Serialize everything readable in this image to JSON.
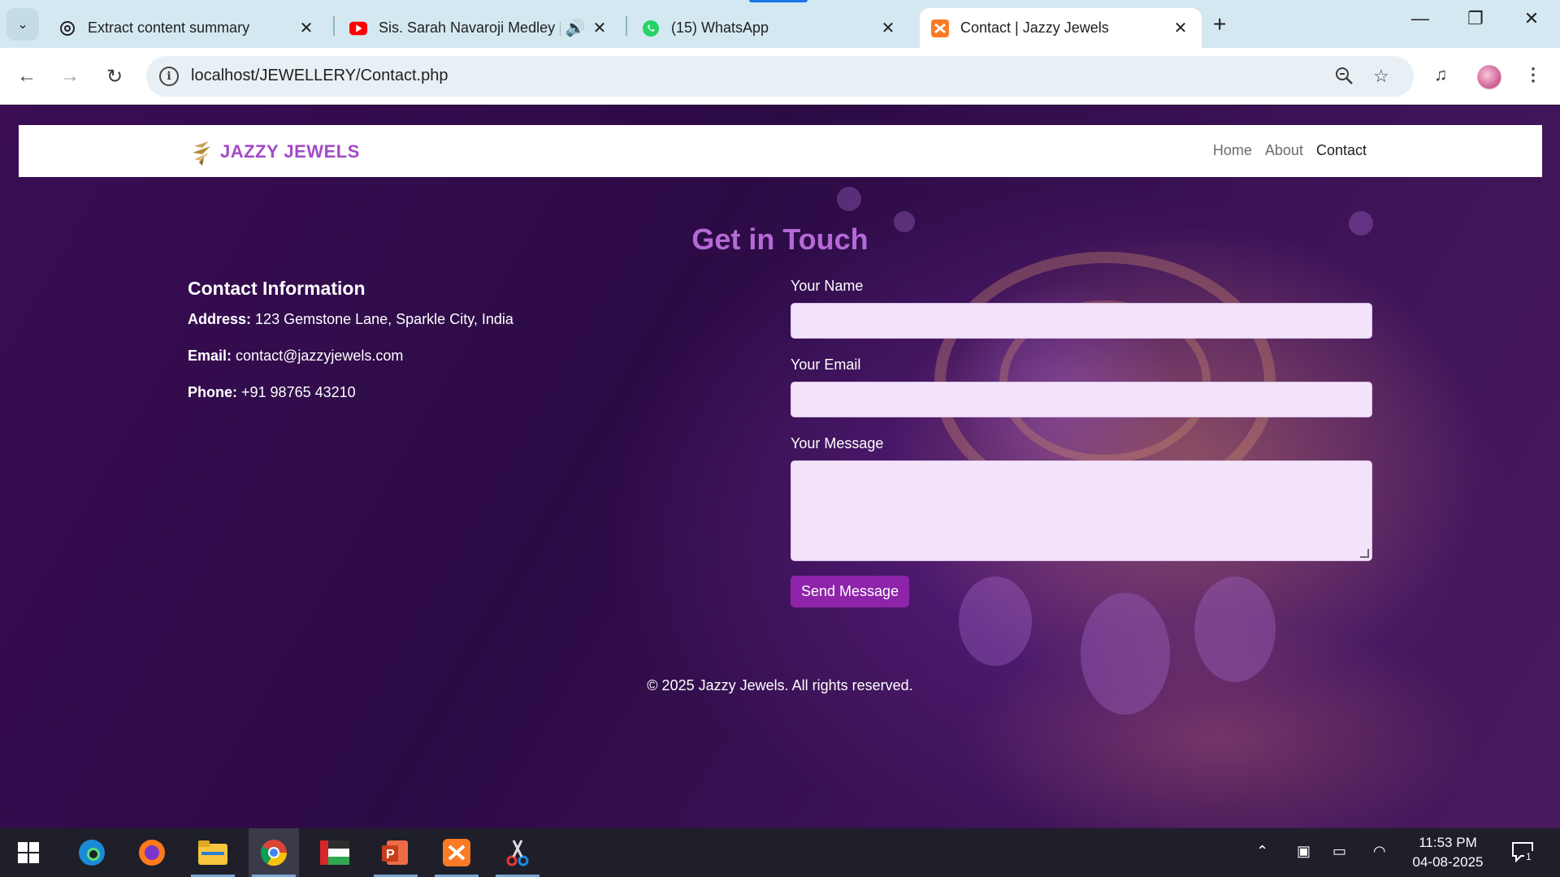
{
  "browser": {
    "tabs": [
      {
        "title": "Extract content summary",
        "icon": "openai-icon"
      },
      {
        "title": "Sis. Sarah Navaroji Medley |",
        "icon": "youtube-icon",
        "audio": true
      },
      {
        "title": "(15) WhatsApp",
        "icon": "whatsapp-icon"
      },
      {
        "title": "Contact | Jazzy Jewels",
        "icon": "xampp-icon",
        "active": true
      }
    ],
    "url": "localhost/JEWELLERY/Contact.php"
  },
  "site": {
    "brand": "JAZZY JEWELS",
    "nav": [
      "Home",
      "About",
      "Contact"
    ],
    "heading": "Get in Touch",
    "contact": {
      "title": "Contact Information",
      "address_label": "Address:",
      "address": "123 Gemstone Lane, Sparkle City, India",
      "email_label": "Email:",
      "email": "contact@jazzyjewels.com",
      "phone_label": "Phone:",
      "phone": "+91 98765 43210"
    },
    "form": {
      "name_label": "Your Name",
      "email_label": "Your Email",
      "message_label": "Your Message",
      "submit": "Send Message"
    },
    "footer": "© 2025 Jazzy Jewels. All rights reserved."
  },
  "taskbar": {
    "time": "11:53 PM",
    "date": "04-08-2025",
    "notifications": "1"
  },
  "colors": {
    "brand": "#a349c9",
    "heading": "#b46ad6",
    "button": "#8e24aa",
    "input_bg": "#f3e3fb"
  }
}
